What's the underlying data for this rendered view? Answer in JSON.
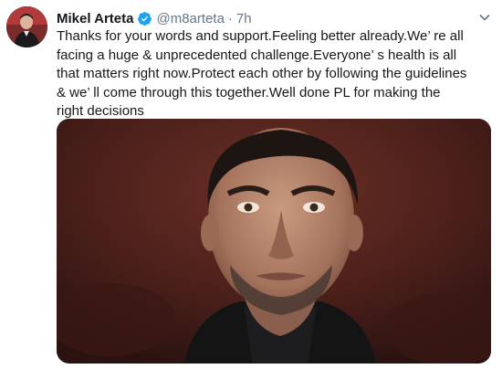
{
  "tweet": {
    "author": {
      "display_name": "Mikel Arteta",
      "handle": "@m8arteta",
      "verified": true,
      "avatar_icon": "profile-photo"
    },
    "separator": "·",
    "time": "7h",
    "text": "Thanks for your words and support.Feeling better already.We’ re all\nfacing a huge & unprecedented challenge.Everyone’ s health is all\nthat matters right now.Protect each other by following the guidelines\n& we’ ll come through this together.Well done PL for making the\nright decisions",
    "media": {
      "kind": "photo",
      "subject": "man-portrait-photo"
    },
    "menu_icon": "chevron-down-icon",
    "colors": {
      "text": "#14171a",
      "muted": "#657786",
      "verified": "#1da1f2"
    }
  }
}
